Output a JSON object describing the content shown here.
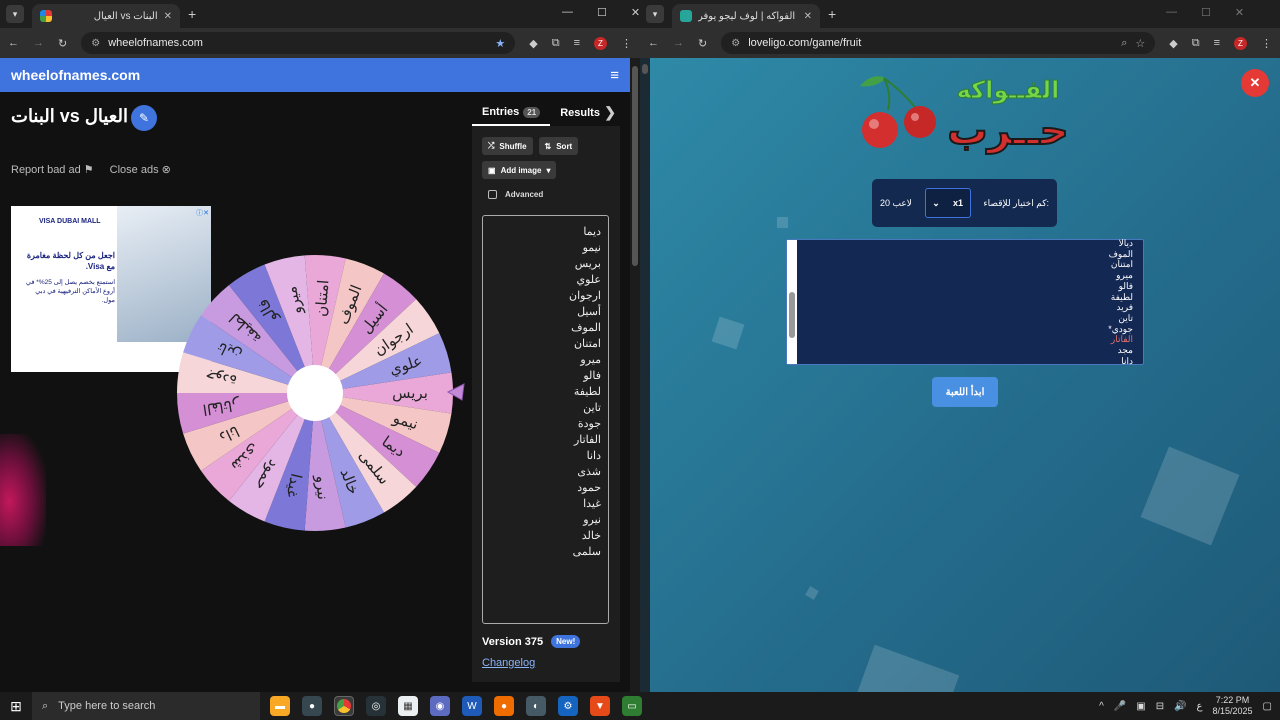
{
  "left_browser": {
    "tab_title": "العيال vs البنات",
    "url": "wheelofnames.com",
    "site": {
      "brand": "wheelofnames.com",
      "wheel_title": "البنات vs العيال",
      "report_bad_ad": "Report bad ad",
      "close_ads": "Close ads",
      "ad": {
        "brand_line": "VISA  DUBAI MALL",
        "headline": "اجعل من كل لحظة مغامرة مع Visa.",
        "body": "استمتع بخصم يصل إلى 25%* في أروع الأماكن الترفيهية في دبي مول."
      },
      "tabs": {
        "entries_label": "Entries",
        "entries_count": "21",
        "results_label": "Results"
      },
      "buttons": {
        "shuffle": "Shuffle",
        "sort": "Sort",
        "add_image": "Add image"
      },
      "advanced_label": "Advanced",
      "entries": [
        "ديما",
        "نيمو",
        "بريس",
        "علوي",
        "ارجوان",
        "أسيل",
        "الموف",
        "امتنان",
        "ميرو",
        "فالو",
        "لطيفة",
        "تاين",
        "جودة",
        "الفاتار",
        "دانا",
        "شذى",
        "حمود",
        "غيدا",
        "نيرو",
        "خالد",
        "سلمى"
      ],
      "wheel_labels": [
        "بريس",
        "نيمو",
        "ديما",
        "سلمى",
        "خالد",
        "نيرو",
        "غيدا",
        "حمود",
        "شذى",
        "دانا",
        "الفاتار",
        "جودة",
        "تاين",
        "لطيفة",
        "فالو",
        "ميرو",
        "امتنان",
        "الموف",
        "أسيل",
        "ارجوان",
        "علوي"
      ],
      "version_label": "Version 375",
      "new_badge": "New!",
      "changelog": "Changelog"
    }
  },
  "right_browser": {
    "tab_title": "لعبة حرب الفواكه | لوف ليجو يوفر",
    "url": "loveligo.com/game/fruit",
    "site": {
      "logo_top": "الفــواكه",
      "logo_bottom": "حــرب",
      "eliminate_label": "كم اختيار للإقصاء:",
      "select_value": "x1",
      "players_label": "20 لاعب",
      "names": [
        "ديالا",
        "الموف",
        "امتنان",
        "ميرو",
        "فالو",
        "لطيفة",
        "فريد",
        "تاين",
        "جودي*",
        "الفاتار",
        "مجد",
        "دانا"
      ],
      "start_button": "ابدأ اللعبة"
    }
  },
  "taskbar": {
    "search_placeholder": "Type here to search",
    "lang": "ع",
    "time": "7:22 PM",
    "date": "8/15/2025"
  },
  "colors": {
    "brand_blue": "#3f74df",
    "wheel_palette": [
      "#e9a8d8",
      "#f4c6c6",
      "#d58fd5",
      "#f6d6d8",
      "#9f9be6",
      "#c89be0",
      "#7d78d8",
      "#e3b6e6"
    ],
    "fruit_bg": "#2a7a9a",
    "close_red": "#e53935"
  }
}
